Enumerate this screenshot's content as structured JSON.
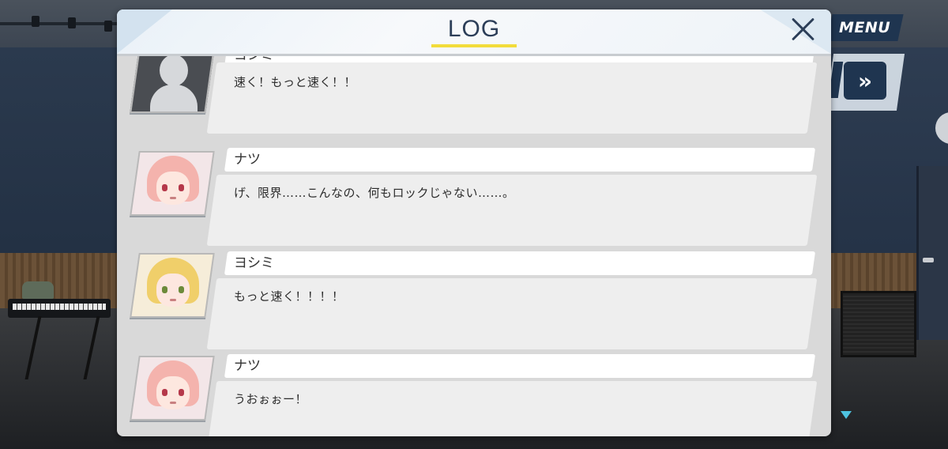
{
  "header": {
    "title": "LOG"
  },
  "controls": {
    "menu_label": "MENU",
    "fast_forward_label": "»"
  },
  "entries": [
    {
      "speaker": "ヨシミ",
      "text": "速く！もっと速く！！",
      "avatar": "silhouette"
    },
    {
      "speaker": "ナツ",
      "text": "げ、限界……こんなの、何もロックじゃない……。",
      "avatar": "natsu"
    },
    {
      "speaker": "ヨシミ",
      "text": "もっと速く！！！！",
      "avatar": "yoshimi"
    },
    {
      "speaker": "ナツ",
      "text": "うおぉぉー！",
      "avatar": "natsu"
    }
  ],
  "colors": {
    "accent_underline": "#f2dc3a",
    "title_text": "#2c3e58",
    "menu_button": "#1f3550",
    "scroll_indicator": "#4ec3e0"
  }
}
